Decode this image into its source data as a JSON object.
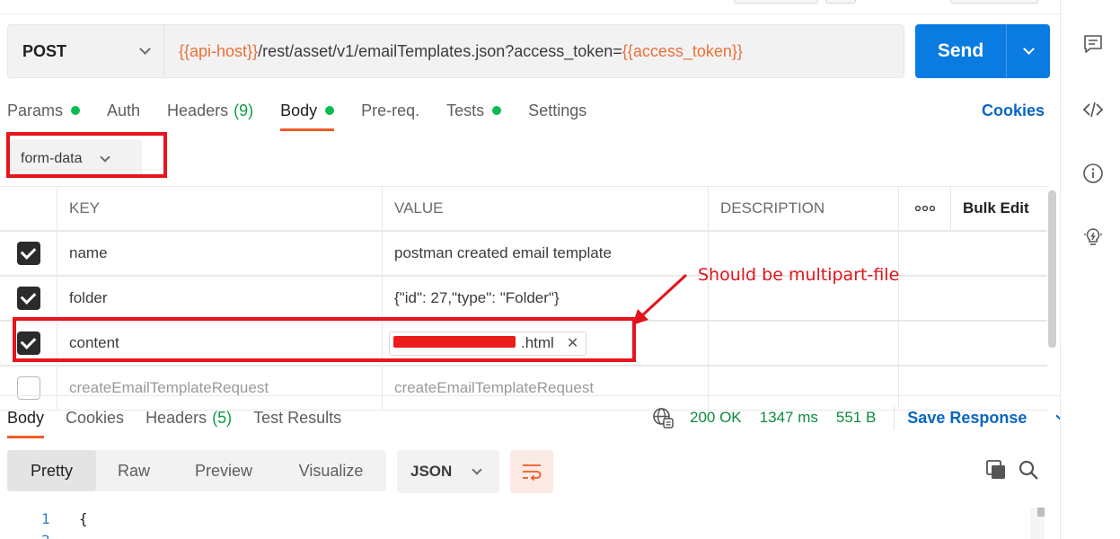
{
  "request": {
    "method": "POST",
    "url_parts": {
      "host_var": "{{api-host}}",
      "path": "/rest/asset/v1/emailTemplates.json?access_token=",
      "token_var": "{{access_token}}"
    },
    "send_label": "Send"
  },
  "req_tabs": {
    "params": "Params",
    "auth": "Auth",
    "headers": "Headers",
    "headers_count": "(9)",
    "body": "Body",
    "prereq": "Pre-req.",
    "tests": "Tests",
    "settings": "Settings",
    "cookies": "Cookies"
  },
  "body_type": "form-data",
  "table": {
    "headers": {
      "key": "KEY",
      "value": "VALUE",
      "description": "DESCRIPTION",
      "more": "ooo",
      "bulk_edit": "Bulk Edit"
    },
    "rows": [
      {
        "key": "name",
        "value": "postman created email template",
        "checked": true
      },
      {
        "key": "folder",
        "value": "{\"id\": 27,\"type\": \"Folder\"}",
        "checked": true
      },
      {
        "key": "content",
        "value": ".html",
        "checked": true
      },
      {
        "key": "createEmailTemplateRequest",
        "value": "createEmailTemplateRequest",
        "checked": false
      }
    ]
  },
  "annotation": "Should be multipart-file",
  "response": {
    "tabs": {
      "body": "Body",
      "cookies": "Cookies",
      "headers": "Headers",
      "headers_count": "(5)",
      "test_results": "Test Results"
    },
    "status": "200 OK",
    "time": "1347 ms",
    "size": "551 B",
    "save_label": "Save Response",
    "views": [
      "Pretty",
      "Raw",
      "Preview",
      "Visualize"
    ],
    "format": "JSON",
    "code": [
      {
        "line": "1",
        "text": "{"
      }
    ]
  },
  "colors": {
    "accent": "#ef5b25",
    "send": "#0a7be0",
    "variable": "#e8703a",
    "success": "#0f8a3e",
    "annotation": "#e1141b"
  }
}
